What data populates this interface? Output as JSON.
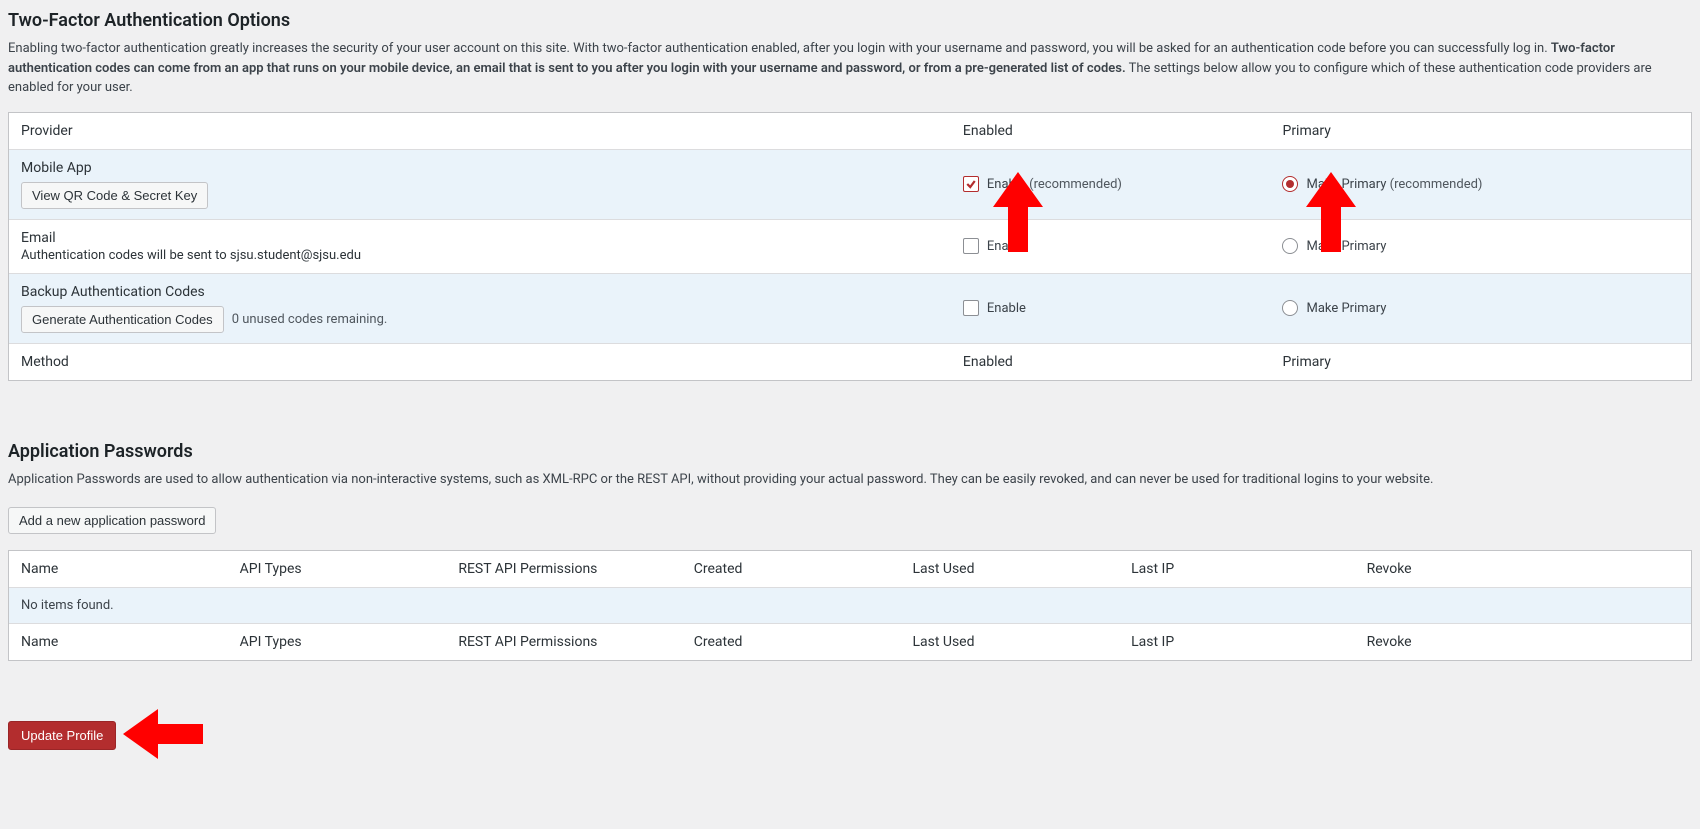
{
  "tfa": {
    "title": "Two-Factor Authentication Options",
    "intro_pre": "Enabling two-factor authentication greatly increases the security of your user account on this site. With two-factor authentication enabled, after you login with your username and password, you will be asked for an authentication code before you can successfully log in. ",
    "intro_strong": "Two-factor authentication codes can come from an app that runs on your mobile device, an email that is sent to you after you login with your username and password, or from a pre-generated list of codes.",
    "intro_post": " The settings below allow you to configure which of these authentication code providers are enabled for your user.",
    "headers": {
      "provider": "Provider",
      "enabled": "Enabled",
      "primary": "Primary"
    },
    "footers": {
      "method": "Method",
      "enabled": "Enabled",
      "primary": "Primary"
    },
    "labels": {
      "enable": "Enable",
      "make_primary": "Make Primary",
      "recommended": "(recommended)"
    },
    "rows": [
      {
        "name": "Mobile App",
        "sub_button": "View QR Code & Secret Key",
        "enable_checked": true,
        "enable_recommended": true,
        "primary_checked": true,
        "primary_recommended": true
      },
      {
        "name": "Email",
        "sub_text": "Authentication codes will be sent to sjsu.student@sjsu.edu",
        "enable_checked": false,
        "enable_recommended": false,
        "primary_checked": false,
        "primary_recommended": false
      },
      {
        "name": "Backup Authentication Codes",
        "sub_button": "Generate Authentication Codes",
        "sub_after_button": "0 unused codes remaining.",
        "enable_checked": false,
        "enable_recommended": false,
        "primary_checked": false,
        "primary_recommended": false
      }
    ]
  },
  "apppw": {
    "title": "Application Passwords",
    "intro": "Application Passwords are used to allow authentication via non-interactive systems, such as XML-RPC or the REST API, without providing your actual password. They can be easily revoked, and can never be used for traditional logins to your website.",
    "add_button": "Add a new application password",
    "headers": [
      "Name",
      "API Types",
      "REST API Permissions",
      "Created",
      "Last Used",
      "Last IP",
      "Revoke"
    ],
    "empty": "No items found."
  },
  "submit": {
    "label": "Update Profile"
  }
}
